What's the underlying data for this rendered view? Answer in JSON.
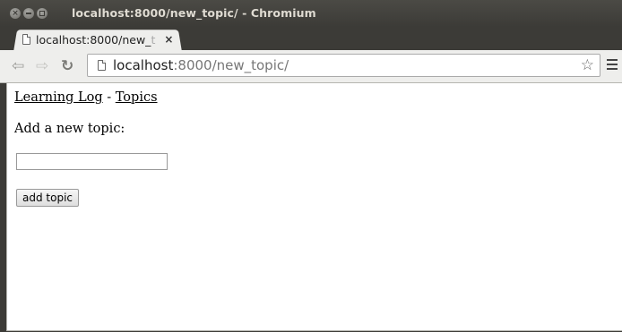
{
  "window": {
    "title": "localhost:8000/new_topic/ - Chromium"
  },
  "tabs": [
    {
      "title": "localhost:8000/new_",
      "title_fade": "t"
    }
  ],
  "address_bar": {
    "host": "localhost",
    "path": ":8000/new_topic/"
  },
  "page": {
    "breadcrumb": {
      "home_link": "Learning Log",
      "separator": "-",
      "topics_link": "Topics"
    },
    "heading": "Add a new topic:",
    "form": {
      "text_value": "",
      "submit_label": "add topic"
    }
  }
}
